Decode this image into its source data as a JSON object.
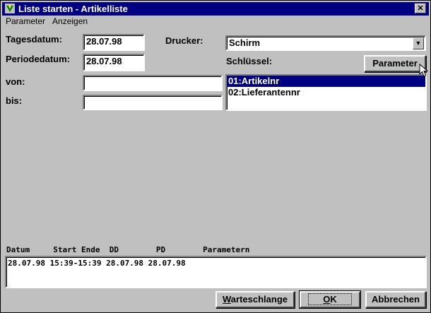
{
  "window": {
    "title": "Liste starten - Artikelliste",
    "close_glyph": "✕"
  },
  "menu": [
    {
      "label": "Parameter"
    },
    {
      "label": "Anzeigen"
    }
  ],
  "form": {
    "tagesdatum_label": "Tagesdatum:",
    "tagesdatum_value": "28.07.98",
    "periodedatum_label": "Periodedatum:",
    "periodedatum_value": "28.07.98",
    "von_label": "von:",
    "von_value": "",
    "bis_label": "bis:",
    "bis_value": "",
    "drucker_label": "Drucker:",
    "drucker_value": "Schirm",
    "schluessel_label": "Schlüssel:",
    "parameter_button": "Parameter",
    "keys": [
      {
        "label": "01:Artikelnr",
        "selected": true
      },
      {
        "label": "02:Lieferantennr",
        "selected": false
      }
    ]
  },
  "history": {
    "header": "Datum     Start Ende  DD        PD        Parametern",
    "rows": [
      "28.07.98 15:39-15:39 28.07.98 28.07.98"
    ]
  },
  "buttons": {
    "queue": {
      "label_u": "W",
      "label_rest": "arteschlange"
    },
    "ok": {
      "label_u": "O",
      "label_rest": "K"
    },
    "cancel": {
      "label": "Abbrechen"
    }
  },
  "icons": {
    "app": "app-icon",
    "combo": "chevron-down-icon",
    "cursor": "mouse-pointer-icon"
  },
  "colors": {
    "titlebar": "#000080",
    "face": "#c0c0c0",
    "selection": "#000080"
  }
}
